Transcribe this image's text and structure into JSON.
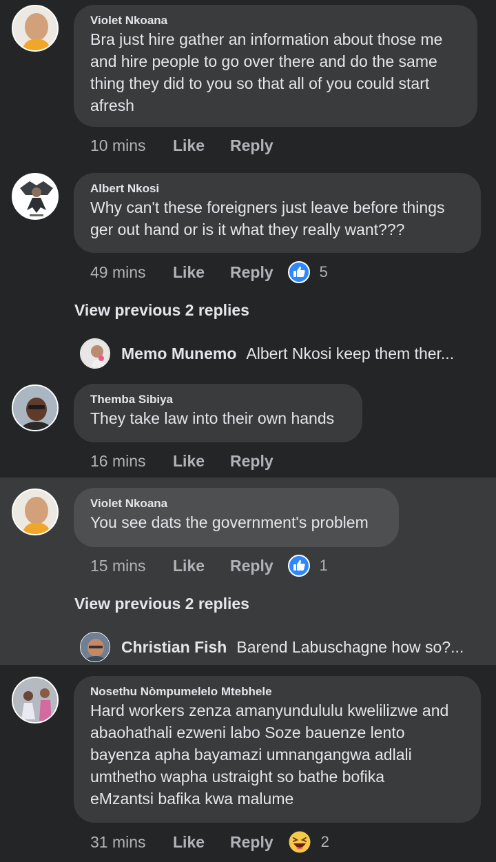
{
  "comments": [
    {
      "author": "Violet Nkoana",
      "lines": [
        "Bra just hire gather an information about those me",
        "and hire people to go over there and do the same",
        "thing they did to you so that all of you could start",
        "afresh"
      ],
      "time": "10 mins",
      "like": "Like",
      "reply": "Reply"
    },
    {
      "author": "Albert Nkosi",
      "lines": [
        "Why can't these foreigners  just leave before things",
        "ger out hand or is it what they really want???"
      ],
      "time": "49 mins",
      "like": "Like",
      "reply": "Reply",
      "reaction": {
        "icon": "thumbs-up-icon",
        "count": "5"
      },
      "view_replies": "View previous 2 replies",
      "latest_reply": {
        "author": "Memo Munemo",
        "text": "Albert Nkosi keep them ther..."
      }
    },
    {
      "author": "Themba Sibiya",
      "lines": [
        "They take law into their own hands"
      ],
      "time": "16 mins",
      "like": "Like",
      "reply": "Reply"
    },
    {
      "author": "Violet Nkoana",
      "lines": [
        "You see dats the government's problem"
      ],
      "time": "15 mins",
      "like": "Like",
      "reply": "Reply",
      "reaction": {
        "icon": "thumbs-up-icon",
        "count": "1"
      },
      "view_replies": "View previous 2 replies",
      "latest_reply": {
        "author": "Christian Fish",
        "text": "Barend Labuschagne how so?..."
      }
    },
    {
      "author": "Nosethu Nòmpumelelo Mtebhele",
      "lines": [
        "Hard workers zenza amanyundululu kwelilizwe and",
        "abaohathali ezweni labo Soze bauenze lento",
        "bayenza apha bayamazi umnangangwa adlali",
        "umthetho wapha ustraight so bathe bofika",
        "eMzantsi bafika kwa malume"
      ],
      "time": "31 mins",
      "like": "Like",
      "reply": "Reply",
      "reaction": {
        "icon": "laughing-emoji-icon",
        "count": "2"
      }
    }
  ],
  "colors": {
    "background": "#242526",
    "highlight": "#3a3b3c",
    "bubble": "#3a3b3c",
    "like_blue": "#2d88ff",
    "text": "#e4e6eb",
    "muted": "#b0b3b8"
  }
}
